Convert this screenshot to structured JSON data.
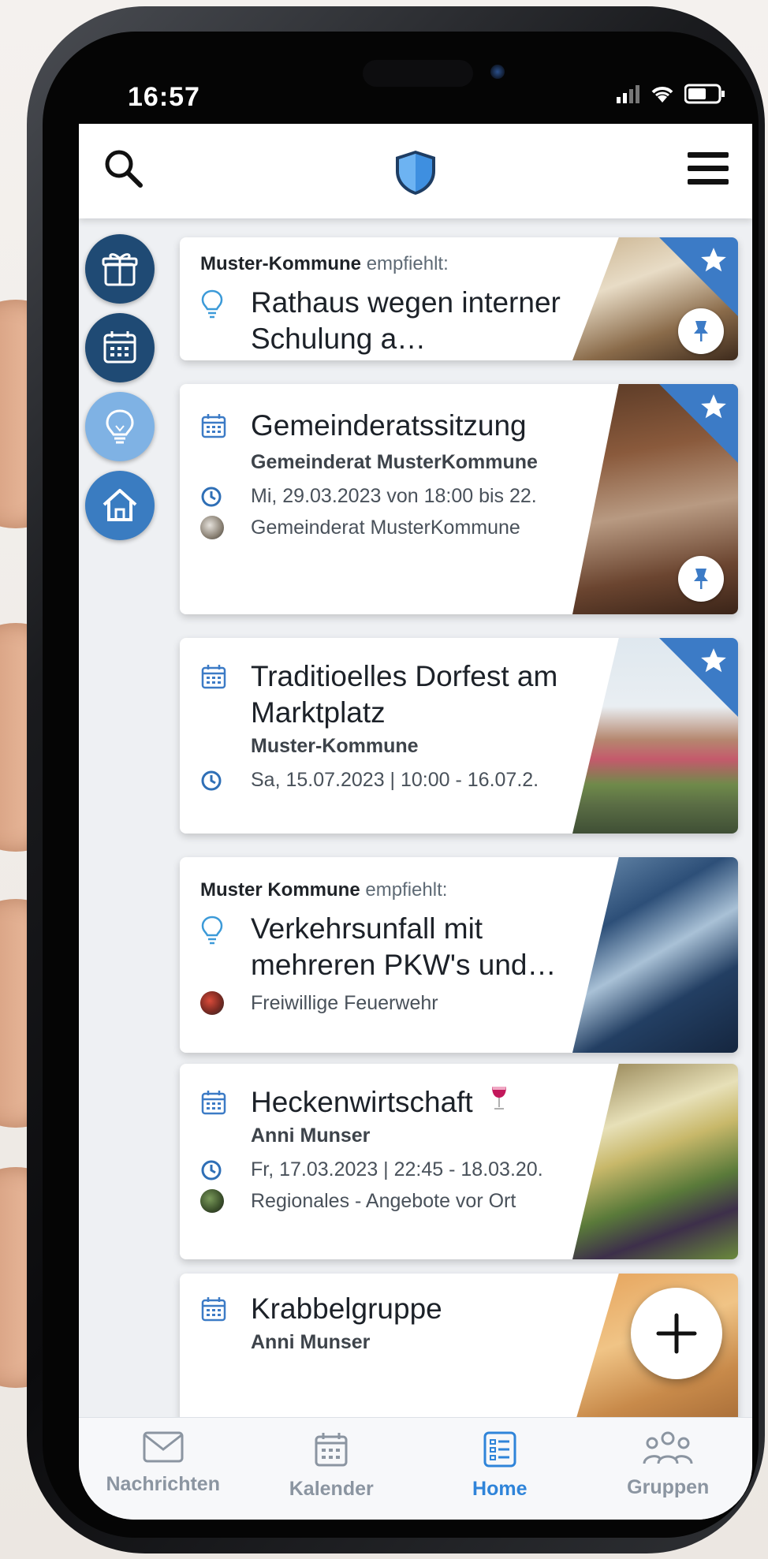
{
  "status": {
    "time": "16:57"
  },
  "colors": {
    "accent": "#2f84d9",
    "ribbon": "#3c7bc6",
    "side_dark": "#1f4a74",
    "side_light": "#7fb2e4"
  },
  "appbar": {
    "search_icon": "search-icon",
    "logo_icon": "shield-icon",
    "menu_icon": "hamburger-menu-icon"
  },
  "side_nav": [
    {
      "icon": "gift-icon"
    },
    {
      "icon": "calendar-icon"
    },
    {
      "icon": "lightbulb-icon"
    },
    {
      "icon": "home-icon"
    }
  ],
  "feed": [
    {
      "type": "recommendation",
      "recommender": "Muster-Kommune",
      "recommends": "empfiehlt:",
      "title": "Rathaus wegen interner Schulung a…",
      "icon": "lightbulb-icon",
      "starred": true,
      "pinned": true
    },
    {
      "type": "event",
      "title": "Gemeinderatssitzung",
      "subtitle": "Gemeinderat MusterKommune",
      "datetime": "Mi, 29.03.2023 von 18:00 bis 22.",
      "group": "Gemeinderat MusterKommune",
      "starred": true,
      "pinned": true
    },
    {
      "type": "event",
      "title": "Traditioelles Dorfest am Marktplatz",
      "subtitle": "Muster-Kommune",
      "datetime": "Sa, 15.07.2023 | 10:00 - 16.07.2.",
      "starred": true
    },
    {
      "type": "recommendation",
      "recommender": "Muster Kommune",
      "recommends": "empfiehlt:",
      "title": "Verkehrsunfall mit mehreren PKW's und…",
      "group": "Freiwillige Feuerwehr",
      "icon": "lightbulb-icon"
    },
    {
      "type": "event",
      "title": "Heckenwirtschaft",
      "title_icon": "wine-glass-icon",
      "subtitle": "Anni Munser",
      "datetime": "Fr, 17.03.2023 | 22:45 - 18.03.20.",
      "group": "Regionales - Angebote vor Ort"
    },
    {
      "type": "event",
      "title": "Krabbelgruppe",
      "subtitle": "Anni Munser"
    }
  ],
  "fab": {
    "icon": "plus-icon"
  },
  "bottom_nav": [
    {
      "label": "Nachrichten",
      "icon": "envelope-icon",
      "active": false
    },
    {
      "label": "Kalender",
      "icon": "calendar-icon",
      "active": false
    },
    {
      "label": "Home",
      "icon": "list-icon",
      "active": true
    },
    {
      "label": "Gruppen",
      "icon": "people-icon",
      "active": false
    }
  ]
}
